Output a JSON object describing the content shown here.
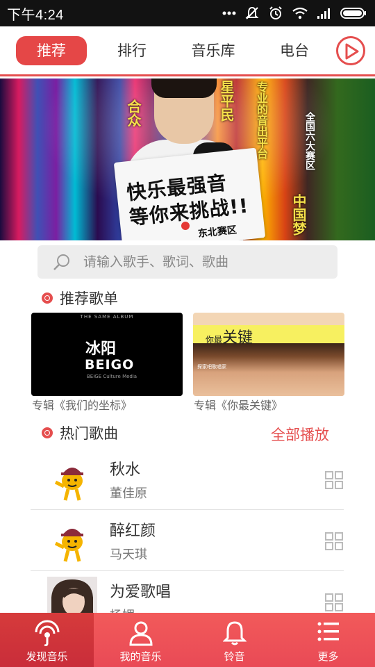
{
  "status_bar": {
    "time": "下午4:24"
  },
  "tabs": [
    {
      "label": "推荐",
      "active": true
    },
    {
      "label": "排行",
      "active": false
    },
    {
      "label": "音乐库",
      "active": false
    },
    {
      "label": "电台",
      "active": false
    }
  ],
  "banner": {
    "card_text": [
      "快乐最强音",
      "等你来挑战!!"
    ],
    "card_sub": "东北赛区",
    "side_texts": [
      "合众",
      "星平民",
      "专业的音出平台",
      "全国六大赛区",
      "中国梦"
    ]
  },
  "search": {
    "placeholder": "请输入歌手、歌词、歌曲"
  },
  "recommended_playlists": {
    "title": "推荐歌单",
    "items": [
      {
        "caption": "专辑《我们的坐标》",
        "cover_top": "THE SAME ALBUM",
        "cover_logo": "冰阳",
        "cover_name": "BEIGO",
        "cover_sub": "BEIGE Culture Media"
      },
      {
        "caption": "专辑《你最关键》",
        "cover_title_small": "你最",
        "cover_title_big": "关键",
        "cover_small_text": "探家吧歌唱家"
      }
    ]
  },
  "hot_songs": {
    "title": "热门歌曲",
    "play_all": "全部播放",
    "items": [
      {
        "title": "秋水",
        "artist": "董佳原"
      },
      {
        "title": "醉红颜",
        "artist": "马天琪"
      },
      {
        "title": "为爱歌唱",
        "artist": "杨媚"
      }
    ]
  },
  "bottom_nav": [
    {
      "label": "发现音乐",
      "icon": "discover-music-icon",
      "active": true
    },
    {
      "label": "我的音乐",
      "icon": "user-icon",
      "active": false
    },
    {
      "label": "铃音",
      "icon": "bell-icon",
      "active": false
    },
    {
      "label": "更多",
      "icon": "list-icon",
      "active": false
    }
  ],
  "colors": {
    "accent": "#e54e4e",
    "status_bar": "#121212"
  }
}
